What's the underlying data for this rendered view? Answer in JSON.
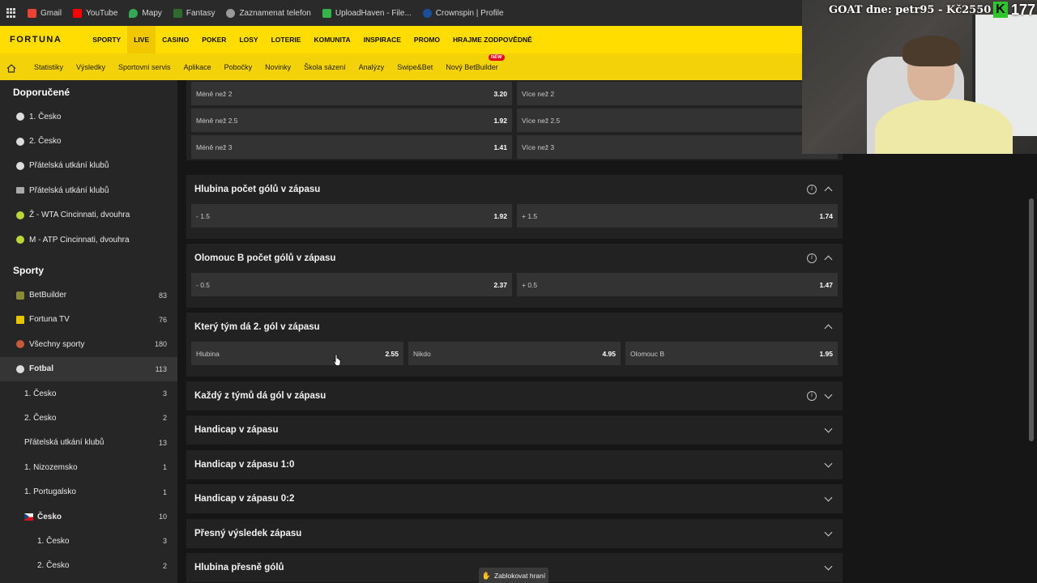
{
  "bookmarks": [
    {
      "label": "Gmail",
      "color": "#ea4335"
    },
    {
      "label": "YouTube",
      "color": "#ff0000"
    },
    {
      "label": "Mapy",
      "color": "#34a853"
    },
    {
      "label": "Fantasy",
      "color": "#2f6b2f"
    },
    {
      "label": "Zaznamenat telefon",
      "color": "#9a9a9a"
    },
    {
      "label": "UploadHaven - File...",
      "color": "#35b548"
    },
    {
      "label": "Crownspin | Profile",
      "color": "#1a4f9c"
    }
  ],
  "topnav": {
    "logo": "FORTUNA",
    "items": [
      "SPORTY",
      "LIVE",
      "CASINO",
      "POKER",
      "LOSY",
      "LOTERIE",
      "KOMUNITA",
      "INSPIRACE",
      "PROMO",
      "HRAJME ZODPOVĚDNĚ"
    ],
    "active": "LIVE"
  },
  "subnav": {
    "items": [
      "Statistiky",
      "Výsledky",
      "Sportovní servis",
      "Aplikace",
      "Pobočky",
      "Novinky",
      "Škola sázení",
      "Analýzy",
      "Swipe&Bet",
      "Nový BetBuilder"
    ],
    "new_badge": "NEW"
  },
  "sidebar": {
    "recommended_title": "Doporučené",
    "recommended": [
      {
        "label": "1. Česko",
        "icon": "soccer-ball-icon"
      },
      {
        "label": "2. Česko",
        "icon": "soccer-ball-icon"
      },
      {
        "label": "Přátelská utkání klubů",
        "icon": "soccer-ball-icon"
      },
      {
        "label": "Přátelská utkání klubů",
        "icon": "flag-icon"
      },
      {
        "label": "Ž - WTA Cincinnati, dvouhra",
        "icon": "tennis-ball-icon"
      },
      {
        "label": "M - ATP Cincinnati, dvouhra",
        "icon": "tennis-ball-icon"
      }
    ],
    "sports_title": "Sporty",
    "sports": [
      {
        "label": "BetBuilder",
        "count": "83"
      },
      {
        "label": "Fortuna TV",
        "count": "76"
      },
      {
        "label": "Všechny sporty",
        "count": "180"
      },
      {
        "label": "Fotbal",
        "count": "113"
      },
      {
        "label": "1. Česko",
        "count": "3"
      },
      {
        "label": "2. Česko",
        "count": "2"
      },
      {
        "label": "Přátelská utkání klubů",
        "count": "13"
      },
      {
        "label": "1. Nizozemsko",
        "count": "1"
      },
      {
        "label": "1. Portugalsko",
        "count": "1"
      },
      {
        "label": "Česko",
        "count": "10"
      },
      {
        "label": "1. Česko",
        "count": "3"
      },
      {
        "label": "2. Česko",
        "count": "2"
      }
    ]
  },
  "markets": {
    "goals_total": {
      "rows": [
        [
          {
            "label": "Méně než 2",
            "odd": "3.20"
          },
          {
            "label": "Více než 2",
            "odd": ""
          }
        ],
        [
          {
            "label": "Méně než 2.5",
            "odd": "1.92"
          },
          {
            "label": "Více než 2.5",
            "odd": ""
          }
        ],
        [
          {
            "label": "Méně než 3",
            "odd": "1.41"
          },
          {
            "label": "Více než 3",
            "odd": ""
          }
        ]
      ]
    },
    "hlubina_goals": {
      "title": "Hlubina počet gólů v zápasu",
      "options": [
        {
          "label": "- 1.5",
          "odd": "1.92"
        },
        {
          "label": "+ 1.5",
          "odd": "1.74"
        }
      ]
    },
    "olomouc_goals": {
      "title": "Olomouc B počet gólů v zápasu",
      "options": [
        {
          "label": "- 0.5",
          "odd": "2.37"
        },
        {
          "label": "+ 0.5",
          "odd": "1.47"
        }
      ]
    },
    "second_goal": {
      "title": "Který tým dá 2. gól v zápasu",
      "options": [
        {
          "label": "Hlubina",
          "odd": "2.55"
        },
        {
          "label": "Nikdo",
          "odd": "4.95"
        },
        {
          "label": "Olomouc B",
          "odd": "1.95"
        }
      ]
    },
    "collapsed": [
      {
        "title": "Každý z týmů dá gól v zápasu",
        "info": true
      },
      {
        "title": "Handicap v zápasu",
        "info": false
      },
      {
        "title": "Handicap v zápasu 1:0",
        "info": false
      },
      {
        "title": "Handicap v zápasu 0:2",
        "info": false
      },
      {
        "title": "Přesný výsledek zápasu",
        "info": false
      },
      {
        "title": "Hlubina přesně gólů",
        "info": false
      }
    ]
  },
  "webcam": {
    "goat_text": "GOAT dne: petr95 - Kč2550",
    "k_badge": "K",
    "k_number": "177"
  },
  "toast": {
    "label": "Zablokovat hraní"
  }
}
